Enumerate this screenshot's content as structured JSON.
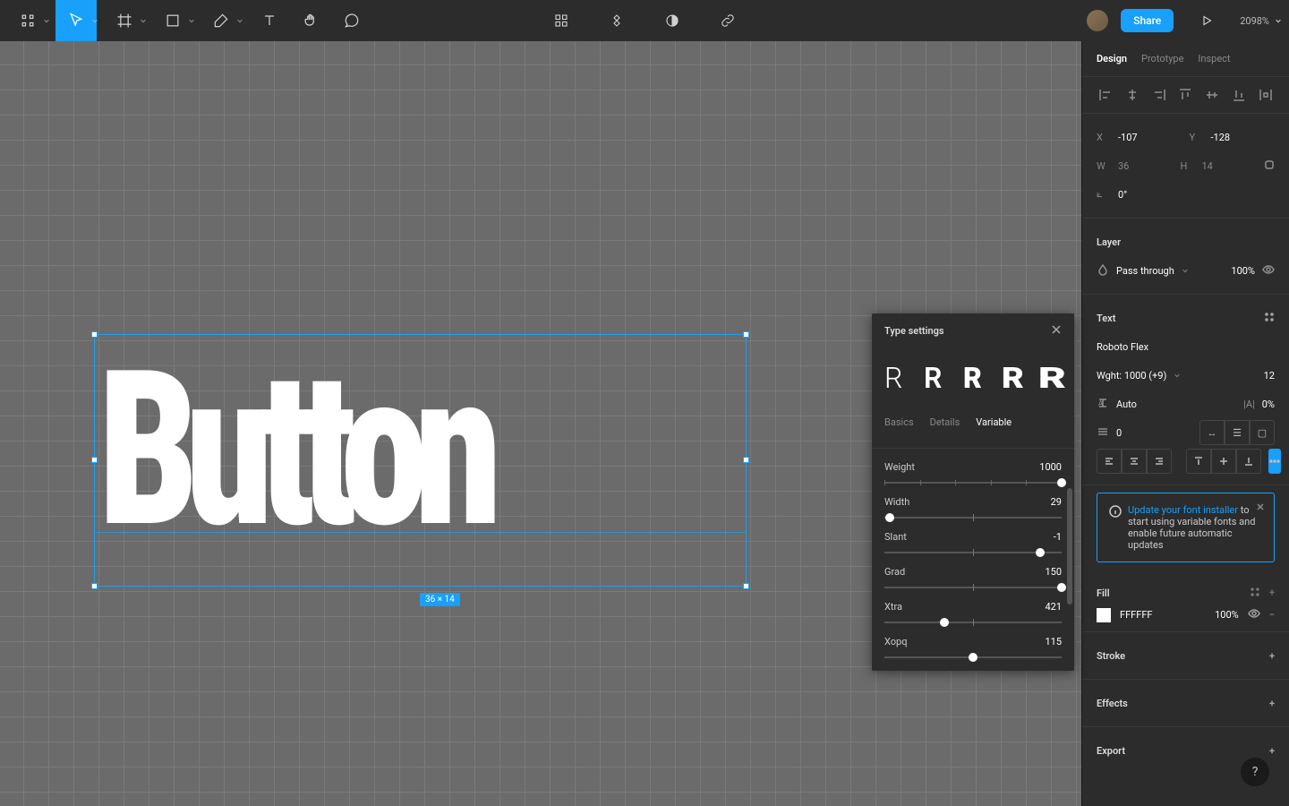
{
  "toolbar": {
    "share_label": "Share",
    "zoom": "2098%"
  },
  "canvas": {
    "text": "Button",
    "dimensions": "36 × 14"
  },
  "type_settings": {
    "title": "Type settings",
    "tabs": {
      "basics": "Basics",
      "details": "Details",
      "variable": "Variable"
    },
    "axes": [
      {
        "label": "Weight",
        "value": "1000",
        "pos": 100
      },
      {
        "label": "Width",
        "value": "29",
        "pos": 3
      },
      {
        "label": "Slant",
        "value": "-1",
        "pos": 88
      },
      {
        "label": "Grad",
        "value": "150",
        "pos": 100
      },
      {
        "label": "Xtra",
        "value": "421",
        "pos": 34
      },
      {
        "label": "Xopq",
        "value": "115",
        "pos": 50
      }
    ]
  },
  "right_panel": {
    "tabs": {
      "design": "Design",
      "prototype": "Prototype",
      "inspect": "Inspect"
    },
    "pos": {
      "x_label": "X",
      "x": "-107",
      "y_label": "Y",
      "y": "-128",
      "w_label": "W",
      "w": "36",
      "h_label": "H",
      "h": "14",
      "rot_label": "⟀",
      "rot": "0°"
    },
    "layer": {
      "title": "Layer",
      "blend": "Pass through",
      "opacity": "100%"
    },
    "text": {
      "title": "Text",
      "font": "Roboto Flex",
      "weight": "Wght: 1000 (+9)",
      "size": "12",
      "lh_mode": "Auto",
      "ls": "0%",
      "para": "0"
    },
    "callout": {
      "link": "Update your font installer",
      "body": "to start using variable fonts and enable future automatic updates"
    },
    "fill": {
      "title": "Fill",
      "hex": "FFFFFF",
      "opacity": "100%"
    },
    "stroke": {
      "title": "Stroke"
    },
    "effects": {
      "title": "Effects"
    },
    "export": {
      "title": "Export"
    }
  }
}
